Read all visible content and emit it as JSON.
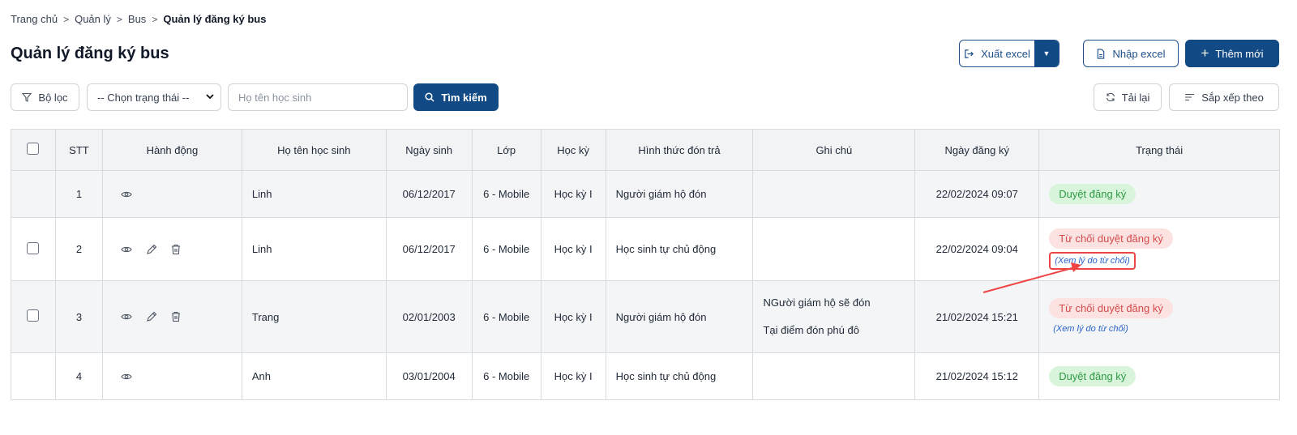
{
  "breadcrumb": {
    "items": [
      "Trang chủ",
      "Quản lý",
      "Bus"
    ],
    "current": "Quản lý đăng ký bus",
    "separator": ">"
  },
  "page": {
    "title": "Quản lý đăng ký bus"
  },
  "toolbar": {
    "export_label": "Xuất excel",
    "import_label": "Nhập excel",
    "add_label": "Thêm mới",
    "add_icon": "+"
  },
  "filters": {
    "filter_label": "Bộ lọc",
    "status_selected": "-- Chọn trạng thái --",
    "name_placeholder": "Họ tên học sinh",
    "search_label": "Tìm kiếm",
    "reload_label": "Tải lại",
    "sort_label": "Sắp xếp theo"
  },
  "table": {
    "headers": [
      "STT",
      "Hành động",
      "Họ tên học sinh",
      "Ngày sinh",
      "Lớp",
      "Học kỳ",
      "Hình thức đón trả",
      "Ghi chú",
      "Ngày đăng ký",
      "Trạng thái"
    ],
    "rows": [
      {
        "stt": "1",
        "name": "Linh",
        "dob": "06/12/2017",
        "class": "6 - Mobile",
        "term": "Học kỳ I",
        "pickup": "Người giám hộ đón",
        "note1": "",
        "note2": "",
        "registered": "22/02/2024 09:07",
        "status": "Duyệt đăng ký",
        "status_type": "approved",
        "reason_link": ""
      },
      {
        "stt": "2",
        "name": "Linh",
        "dob": "06/12/2017",
        "class": "6 - Mobile",
        "term": "Học kỳ I",
        "pickup": "Học sinh tự chủ động",
        "note1": "",
        "note2": "",
        "registered": "22/02/2024 09:04",
        "status": "Từ chối duyệt đăng ký",
        "status_type": "rejected",
        "reason_link": "(Xem lý do từ chối)"
      },
      {
        "stt": "3",
        "name": "Trang",
        "dob": "02/01/2003",
        "class": "6 - Mobile",
        "term": "Học kỳ I",
        "pickup": "Người giám hộ đón",
        "note1": "NGười giám hộ sẽ đón",
        "note2": "Tại điểm đón phú đô",
        "registered": "21/02/2024 15:21",
        "status": "Từ chối duyệt đăng ký",
        "status_type": "rejected",
        "reason_link": "(Xem lý do từ chối)"
      },
      {
        "stt": "4",
        "name": "Anh",
        "dob": "03/01/2004",
        "class": "6 - Mobile",
        "term": "Học kỳ I",
        "pickup": "Học sinh tự chủ động",
        "note1": "",
        "note2": "",
        "registered": "21/02/2024 15:12",
        "status": "Duyệt đăng ký",
        "status_type": "approved",
        "reason_link": ""
      }
    ]
  },
  "colors": {
    "primary": "#114a85",
    "approved_bg": "#d8f5dc",
    "approved_text": "#2e9a45",
    "rejected_bg": "#fde2e2",
    "rejected_text": "#d44b4b",
    "annotation": "#ef4444"
  }
}
